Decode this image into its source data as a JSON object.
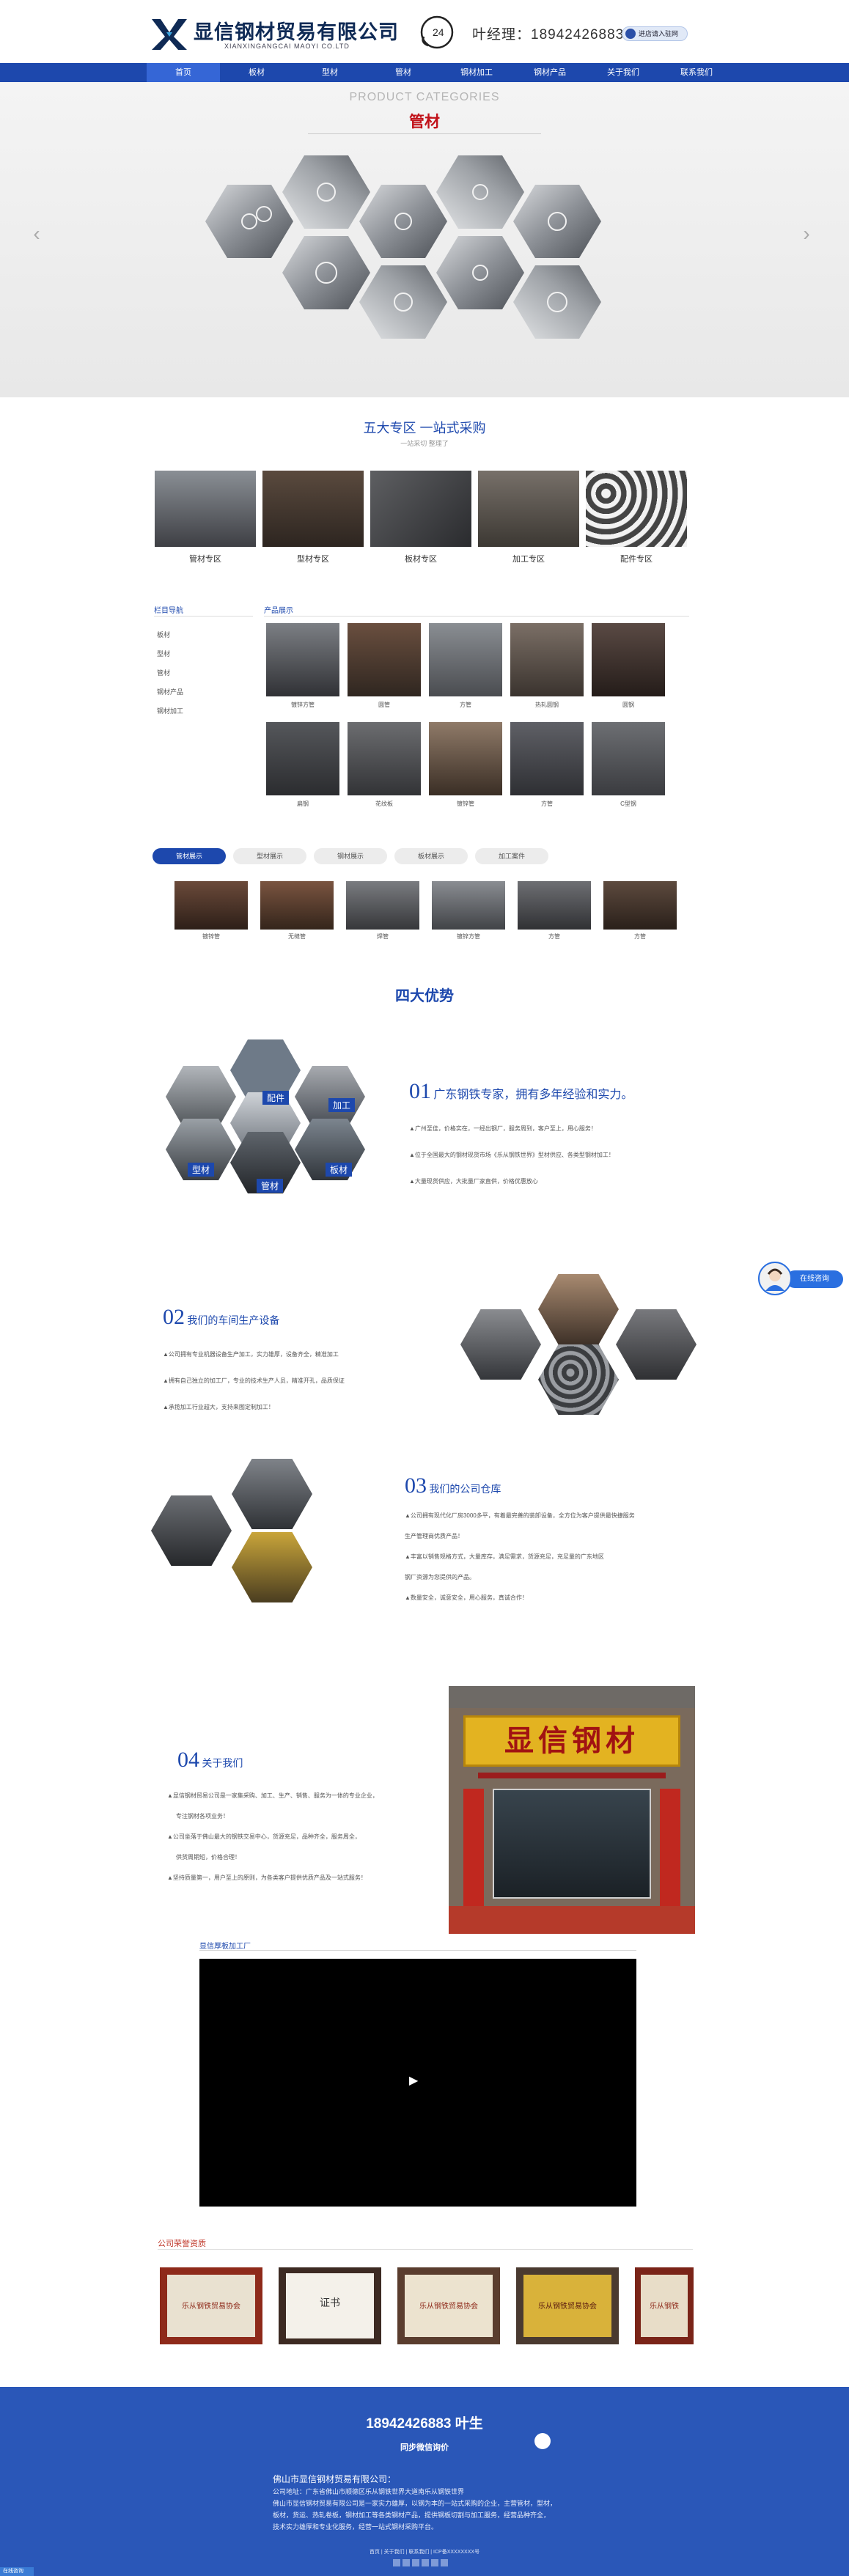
{
  "header": {
    "company_name": "显信钢材贸易有限公司",
    "company_pinyin": "XIANXINGANGCAI MAOYI CO.LTD",
    "phone_badge": "24",
    "phone_text": "叶经理：18942426883",
    "shop_button": "进店请入驻网"
  },
  "nav": [
    "首页",
    "板材",
    "型材",
    "管材",
    "钢材加工",
    "钢材产品",
    "关于我们",
    "联系我们"
  ],
  "banner": {
    "en_title": "PRODUCT CATEGORIES",
    "cn_title": "管材",
    "prev": "‹",
    "next": "›"
  },
  "zones": {
    "title": "五大专区 一站式采购",
    "subtitle": "一站采切 整理了",
    "items": [
      "管材专区",
      "型材专区",
      "板材专区",
      "加工专区",
      "配件专区"
    ]
  },
  "sidebar": {
    "title": "栏目导航",
    "items": [
      "板材",
      "型材",
      "管材",
      "钢材产品",
      "钢材加工"
    ]
  },
  "products": {
    "title": "产品展示",
    "row1": [
      "镀锌方管",
      "圆管",
      "方管",
      "热轧圆钢",
      "圆钢"
    ],
    "row2": [
      "扁钢",
      "花纹板",
      "镀锌管",
      "方管",
      "C型钢"
    ]
  },
  "tabs": {
    "items": [
      "管材展示",
      "型材展示",
      "钢材展示",
      "板材展示",
      "加工案件"
    ],
    "cards": [
      "镀锌管",
      "无缝管",
      "焊管",
      "镀锌方管",
      "方管",
      "方管"
    ]
  },
  "advantages": {
    "title": "四大优势",
    "a1": {
      "num": "01",
      "head": "广东钢铁专家，拥有多年经验和实力。",
      "lines": [
        "▲广州至佳，价格实在，一经出钢厂，服务周到，客户至上，用心服务！",
        "▲位于全国最大的钢材现货市场《乐从钢铁世界》型材供应、各类型钢材加工！",
        "▲大量现货供应，大批量厂家直供，价格优惠放心"
      ],
      "hex_labels": [
        "配件",
        "加工",
        "型材",
        "板材",
        "管材"
      ]
    },
    "a2": {
      "num": "02",
      "head": "我们的车间生产设备",
      "lines": [
        "▲公司拥有专业机器设备生产加工，实力雄厚，设备齐全，精准加工",
        "▲拥有自己独立的加工厂，专业的技术生产人员，精准开孔，品质保证",
        "▲承揽加工行业超大，支持来图定制加工！"
      ]
    },
    "a3": {
      "num": "03",
      "head": "我们的公司仓库",
      "lines": [
        "▲公司拥有现代化厂房3000多平，有着最完善的装卸设备，全方位为客户提供最快捷服务",
        "生产管理商优质产品！",
        "▲丰富以销售规格方式，大量库存，满足需求，货源充足，充足量的广东地区",
        "钢厂资源为您提供的产品。",
        "▲数量安全，诚意安全，用心服务，真诚合作！"
      ]
    },
    "a4": {
      "num": "04",
      "head": "关于我们",
      "lines": [
        "▲显信钢材贸易公司是一家集采购、加工、生产、销售、服务为一体的专业企业，",
        "专注钢材各项业务！",
        "▲公司坐落于佛山最大的钢铁交易中心，货源充足，品种齐全，服务周全，",
        "供货周期短，价格合理！",
        "▲坚持质量第一，用户至上的原则，为各类客户提供优质产品及一站式服务！"
      ],
      "photo_sign": "显信钢材"
    }
  },
  "video": {
    "title": "显信厚板加工厂",
    "play": "▶"
  },
  "honors": {
    "title": "公司荣誉资质",
    "items": [
      "乐从钢铁贸易协会",
      "证书",
      "乐从钢铁贸易协会",
      "乐从钢铁贸易协会",
      "乐从钢铁"
    ]
  },
  "footer": {
    "phone": "18942426883 叶生",
    "wechat": "同步微信询价",
    "company": "佛山市显信钢材贸易有限公司：",
    "lines": [
      "公司地址：广东省佛山市顺德区乐从钢铁世界大道南乐从钢铁世界",
      "佛山市显信钢材贸易有限公司是一家实力雄厚，以钢为本的一站式采购的企业，主营管材，型材，",
      "板材，货运、热轧卷板，钢材加工等各类钢材产品，提供钢板切割与加工服务，经营品种齐全，",
      "技术实力雄厚和专业化服务，经营一站式钢材采购平台。"
    ],
    "links": "首页 | 关于我们 | 联系我们 | ICP备XXXXXXXX号"
  },
  "float": {
    "label": "在线咨询"
  },
  "bottom_badge": "在线咨询"
}
